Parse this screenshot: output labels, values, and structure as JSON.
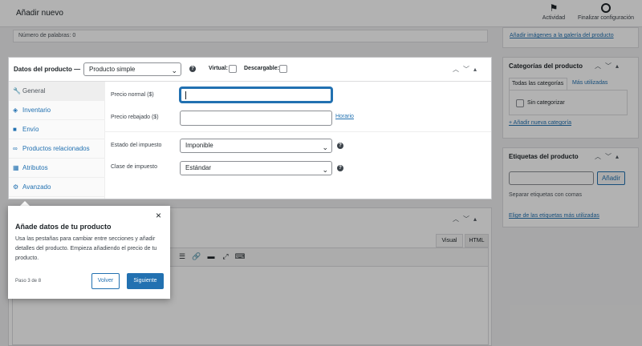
{
  "header": {
    "title": "Añadir nuevo",
    "activity_label": "Actividad",
    "setup_label": "Finalizar configuración"
  },
  "word_count": "Número de palabras: 0",
  "gallery_link": "Añadir imágenes a la galería del producto",
  "categories": {
    "title": "Categorías del producto",
    "tab_all": "Todas las categorías",
    "tab_used": "Más utilizadas",
    "uncategorized": "Sin categorizar",
    "add_new": "+ Añadir nueva categoría"
  },
  "tags": {
    "title": "Etiquetas del producto",
    "add_button": "Añadir",
    "hint": "Separar etiquetas con comas",
    "choose_link": "Elige de las etiquetas más utilizadas"
  },
  "product_data": {
    "title": "Datos del producto —",
    "type_value": "Producto simple",
    "virtual_label": "Virtual:",
    "downloadable_label": "Descargable:",
    "tabs": [
      {
        "label": "General",
        "icon": "wrench-icon"
      },
      {
        "label": "Inventario",
        "icon": "tag-icon"
      },
      {
        "label": "Envío",
        "icon": "truck-icon"
      },
      {
        "label": "Productos relacionados",
        "icon": "link-icon"
      },
      {
        "label": "Atributos",
        "icon": "table-icon"
      },
      {
        "label": "Avanzado",
        "icon": "gear-icon"
      }
    ],
    "regular_price_label": "Precio normal ($)",
    "sale_price_label": "Precio rebajado ($)",
    "schedule_link": "Horario",
    "tax_status_label": "Estado del impuesto",
    "tax_status_value": "Imponible",
    "tax_class_label": "Clase de impuesto",
    "tax_class_value": "Estándar"
  },
  "editor": {
    "visual_tab": "Visual",
    "html_tab": "HTML"
  },
  "tour": {
    "title": "Añade datos de tu producto",
    "body": "Usa las pestañas para cambiar entre secciones y añadir detalles del producto. Empieza añadiendo el precio de tu producto.",
    "step": "Paso 3 de 8",
    "back_label": "Volver",
    "next_label": "Siguiente",
    "close_glyph": "×"
  },
  "colors": {
    "accent": "#2271b1",
    "overlay": "rgba(0,0,0,0.3)"
  }
}
